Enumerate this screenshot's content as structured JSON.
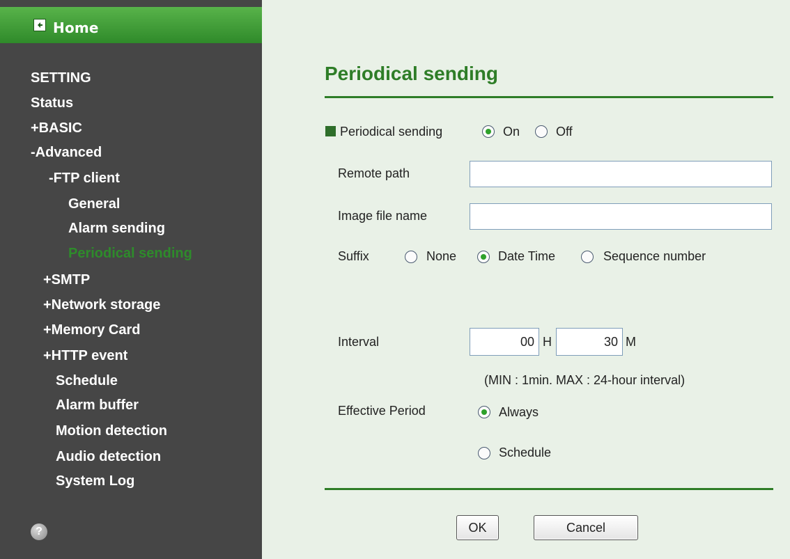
{
  "sidebar": {
    "home_label": "Home",
    "items": [
      {
        "label": "SETTING"
      },
      {
        "label": "Status"
      },
      {
        "label": "+BASIC"
      },
      {
        "label": "-Advanced"
      },
      {
        "label": "-FTP client"
      },
      {
        "label": "General"
      },
      {
        "label": "Alarm sending"
      },
      {
        "label": "Periodical sending",
        "active": true
      },
      {
        "label": "+SMTP"
      },
      {
        "label": "+Network storage"
      },
      {
        "label": "+Memory Card"
      },
      {
        "label": "+HTTP event"
      },
      {
        "label": "Schedule"
      },
      {
        "label": "Alarm buffer"
      },
      {
        "label": "Motion detection"
      },
      {
        "label": "Audio detection"
      },
      {
        "label": "System Log"
      }
    ],
    "help_icon": "?"
  },
  "main": {
    "title": "Periodical sending",
    "periodical": {
      "label": "Periodical sending",
      "on_label": "On",
      "off_label": "Off",
      "selected": "On"
    },
    "remote_path": {
      "label": "Remote path",
      "value": ""
    },
    "image_file_name": {
      "label": "Image file name",
      "value": ""
    },
    "suffix": {
      "label": "Suffix",
      "options": [
        "None",
        "Date Time",
        "Sequence number"
      ],
      "selected": "Date Time"
    },
    "interval": {
      "label": "Interval",
      "hours": "00",
      "hours_unit": "H",
      "minutes": "30",
      "minutes_unit": "M",
      "hint": "(MIN : 1min. MAX : 24-hour interval)"
    },
    "effective_period": {
      "label": "Effective Period",
      "options": [
        "Always",
        "Schedule"
      ],
      "selected": "Always"
    },
    "buttons": {
      "ok": "OK",
      "cancel": "Cancel"
    }
  },
  "colors": {
    "sidebar_bg": "#464646",
    "accent_green": "#2e7d27",
    "content_bg": "#e9f1e7"
  }
}
